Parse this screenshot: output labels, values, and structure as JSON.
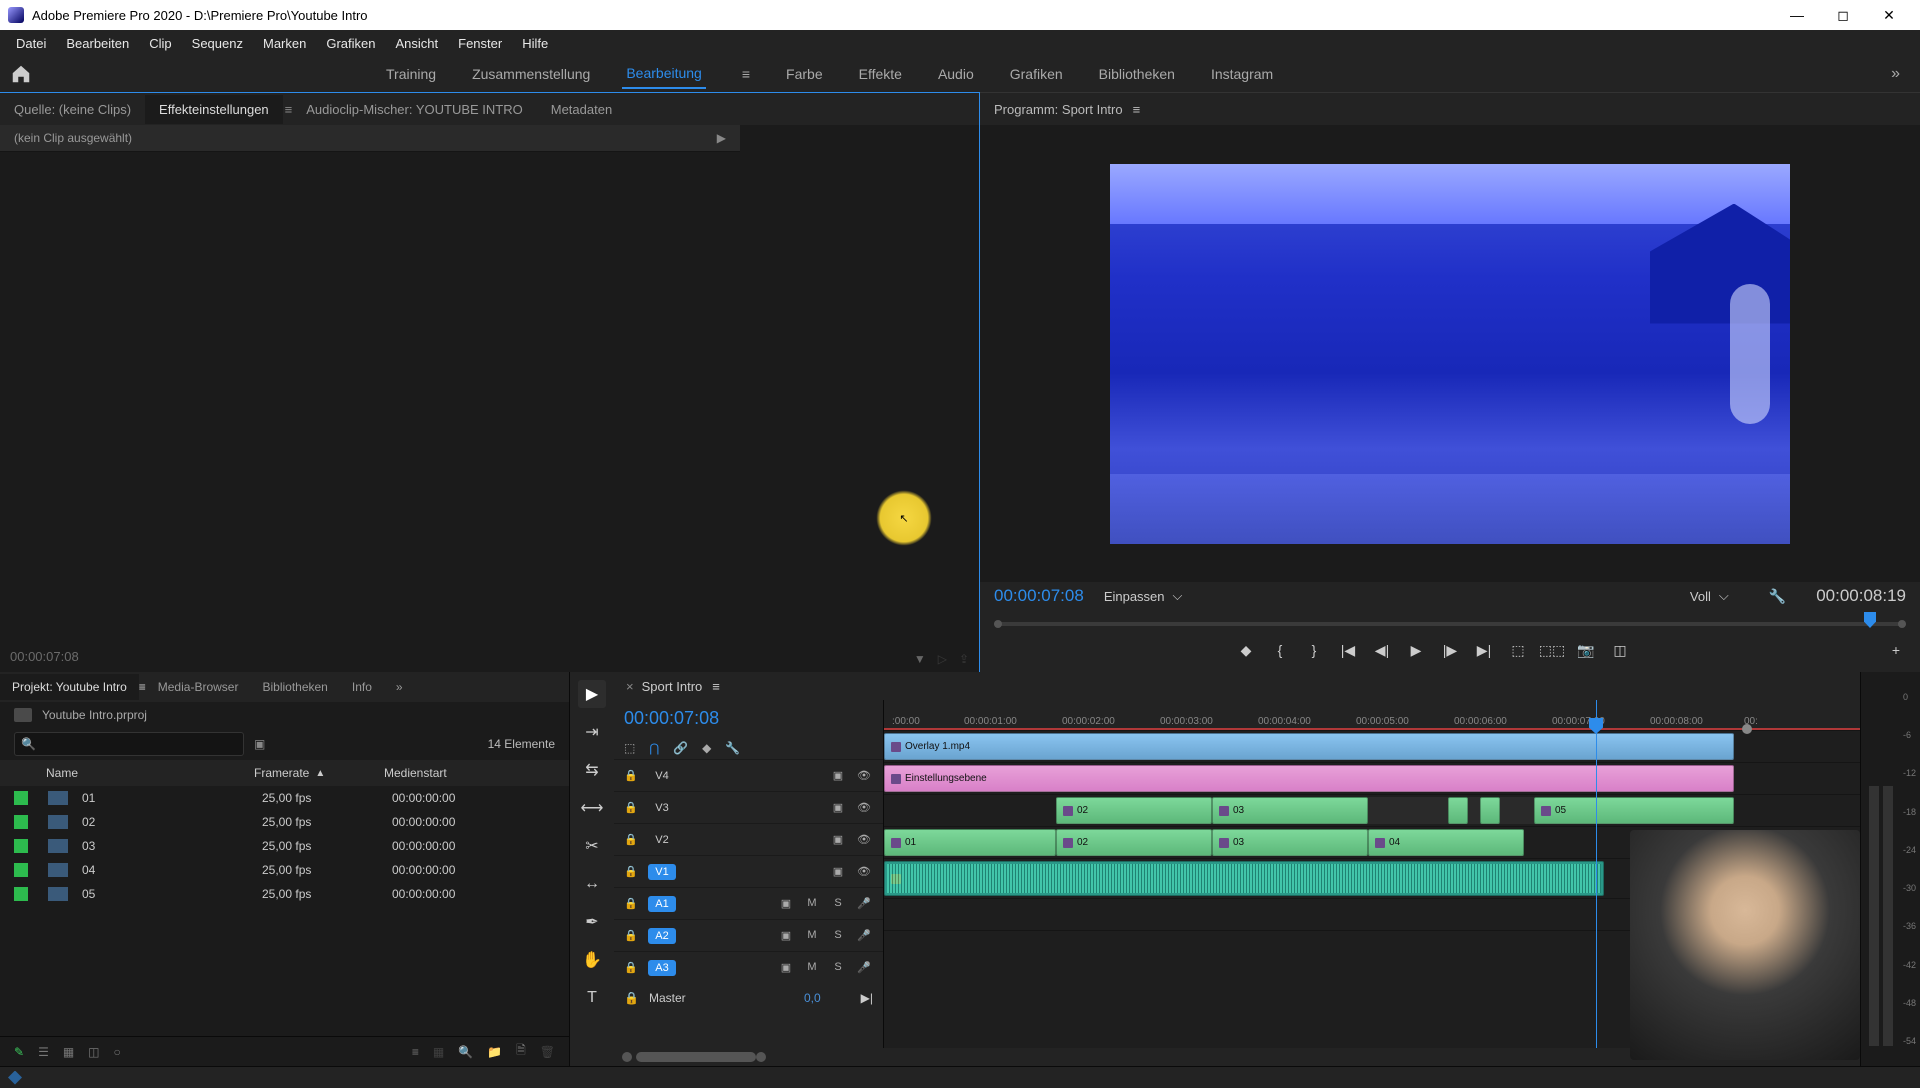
{
  "titlebar": {
    "title": "Adobe Premiere Pro 2020 - D:\\Premiere Pro\\Youtube Intro"
  },
  "menu": [
    "Datei",
    "Bearbeiten",
    "Clip",
    "Sequenz",
    "Marken",
    "Grafiken",
    "Ansicht",
    "Fenster",
    "Hilfe"
  ],
  "workspaces": {
    "items": [
      "Training",
      "Zusammenstellung",
      "Bearbeitung",
      "Farbe",
      "Effekte",
      "Audio",
      "Grafiken",
      "Bibliotheken",
      "Instagram"
    ],
    "active": "Bearbeitung"
  },
  "source_panel": {
    "tabs": {
      "source": "Quelle: (keine Clips)",
      "effect": "Effekteinstellungen",
      "mixer": "Audioclip-Mischer: YOUTUBE INTRO",
      "metadata": "Metadaten"
    },
    "no_clip": "(kein Clip ausgewählt)",
    "timecode": "00:00:07:08"
  },
  "program": {
    "title": "Programm: Sport Intro",
    "timecode_left": "00:00:07:08",
    "timecode_right": "00:00:08:19",
    "fit": "Einpassen",
    "quality": "Voll"
  },
  "project": {
    "tabs": {
      "project": "Projekt: Youtube Intro",
      "media": "Media-Browser",
      "libs": "Bibliotheken",
      "info": "Info"
    },
    "filename": "Youtube Intro.prproj",
    "item_count": "14 Elemente",
    "headers": {
      "name": "Name",
      "framerate": "Framerate",
      "mediastart": "Medienstart"
    },
    "rows": [
      {
        "name": "01",
        "fr": "25,00 fps",
        "ms": "00:00:00:00"
      },
      {
        "name": "02",
        "fr": "25,00 fps",
        "ms": "00:00:00:00"
      },
      {
        "name": "03",
        "fr": "25,00 fps",
        "ms": "00:00:00:00"
      },
      {
        "name": "04",
        "fr": "25,00 fps",
        "ms": "00:00:00:00"
      },
      {
        "name": "05",
        "fr": "25,00 fps",
        "ms": "00:00:00:00"
      }
    ]
  },
  "timeline": {
    "sequence": "Sport Intro",
    "timecode": "00:00:07:08",
    "ruler": [
      ":00:00",
      "00:00:01:00",
      "00:00:02:00",
      "00:00:03:00",
      "00:00:04:00",
      "00:00:05:00",
      "00:00:06:00",
      "00:00:07:00",
      "00:00:08:00",
      "00:"
    ],
    "tracks": {
      "v4": "V4",
      "v3": "V3",
      "v2": "V2",
      "v1": "V1",
      "a1": "A1",
      "a2": "A2",
      "a3": "A3",
      "master": "Master",
      "master_val": "0,0",
      "mute": "M",
      "solo": "S"
    },
    "clips": {
      "overlay": "Overlay 1.mp4",
      "adjustment": "Einstellungsebene",
      "c01": "01",
      "c02": "02",
      "c03": "03",
      "c04": "04",
      "c05": "05"
    }
  },
  "meters": [
    "0",
    "-6",
    "-12",
    "-18",
    "-24",
    "-30",
    "-36",
    "-42",
    "-48",
    "-54"
  ]
}
